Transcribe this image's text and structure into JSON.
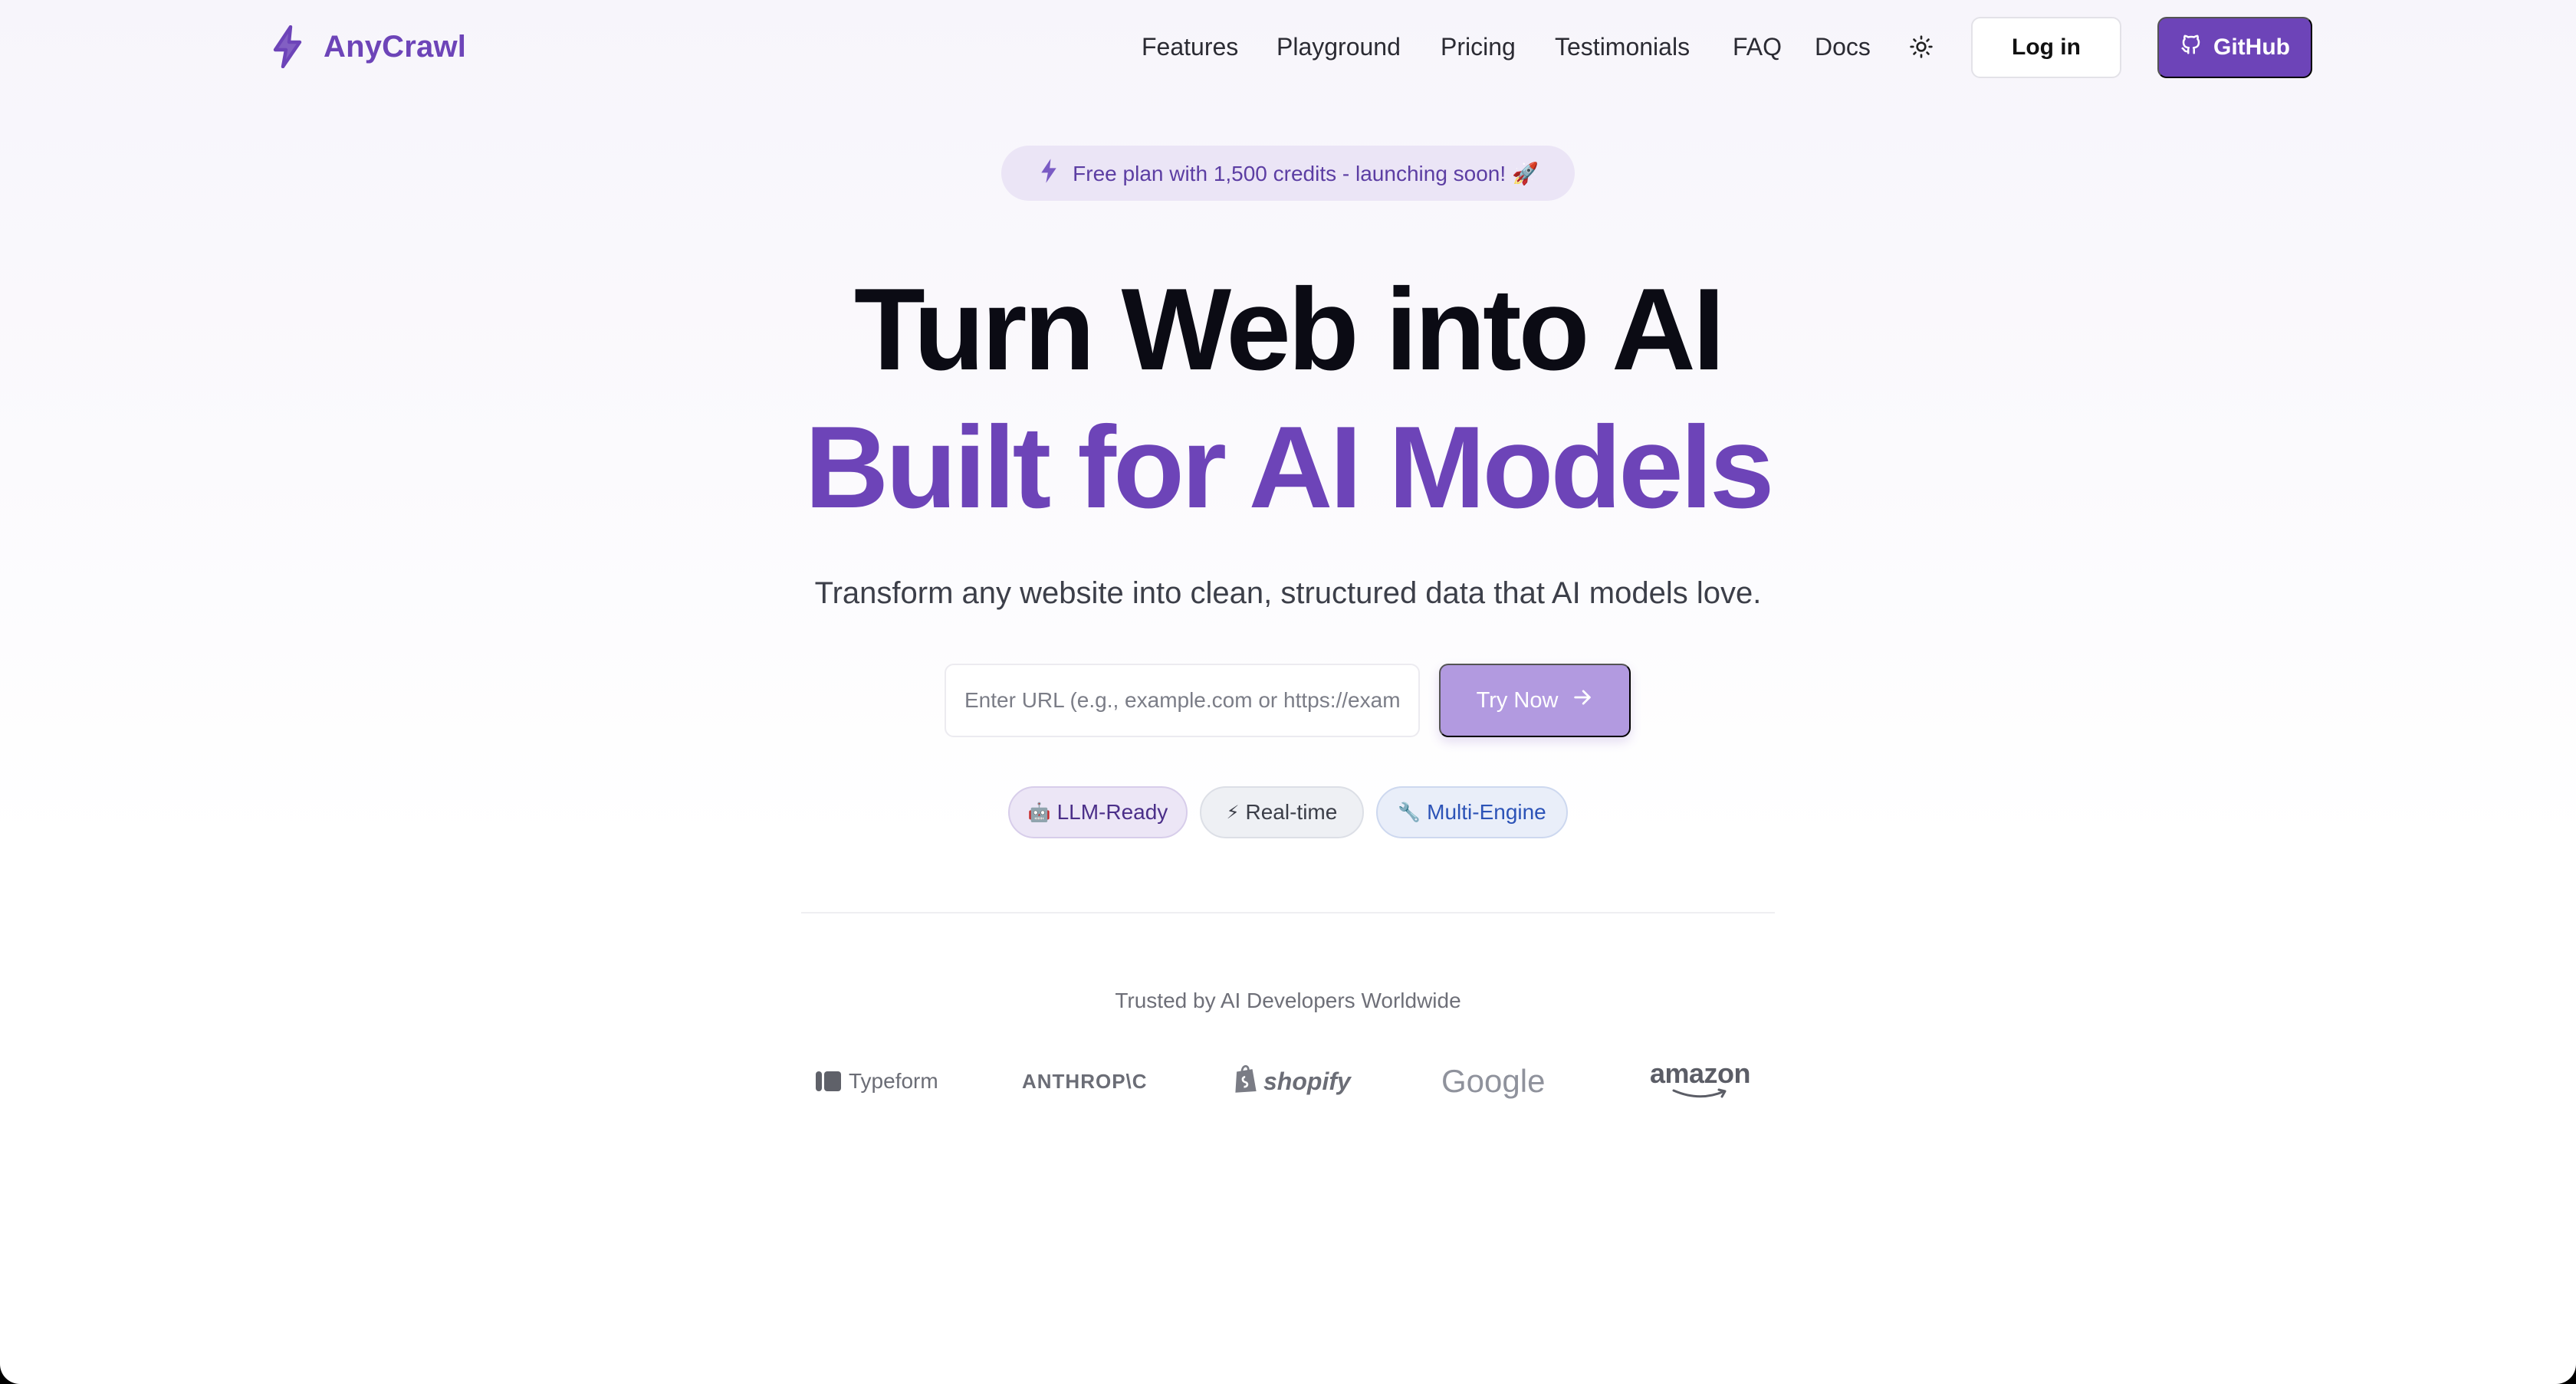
{
  "brand": {
    "name": "AnyCrawl",
    "icon": "lightning-bolt-icon",
    "color": "#6d44b8"
  },
  "nav": {
    "links": [
      {
        "label": "Features"
      },
      {
        "label": "Playground"
      },
      {
        "label": "Pricing"
      },
      {
        "label": "Testimonials"
      },
      {
        "label": "FAQ"
      },
      {
        "label": "Docs"
      }
    ],
    "theme_toggle_icon": "sun-icon",
    "login_label": "Log in",
    "github_label": "GitHub"
  },
  "announcement": {
    "text": "Free plan with 1,500 credits - launching soon! 🚀",
    "icon": "lightning-bolt-icon"
  },
  "hero": {
    "line1": "Turn Web into AI",
    "line2": "Built for AI Models",
    "subtitle": "Transform any website into clean, structured data that AI models love."
  },
  "url_form": {
    "placeholder": "Enter URL (e.g., example.com or https://example.com)",
    "value": "",
    "button_label": "Try Now",
    "button_icon": "arrow-right-icon"
  },
  "tags": [
    {
      "emoji": "🤖",
      "label": "LLM-Ready"
    },
    {
      "emoji": "⚡",
      "label": "Real-time"
    },
    {
      "emoji": "🔧",
      "label": "Multi-Engine"
    }
  ],
  "trusted": {
    "heading": "Trusted by AI Developers Worldwide",
    "logos": [
      "Typeform",
      "ANTHROP\\C",
      "shopify",
      "Google",
      "amazon"
    ]
  },
  "colors": {
    "accent": "#6d44b8",
    "try_button": "#b29ae0",
    "heading": "#0b0b14"
  }
}
